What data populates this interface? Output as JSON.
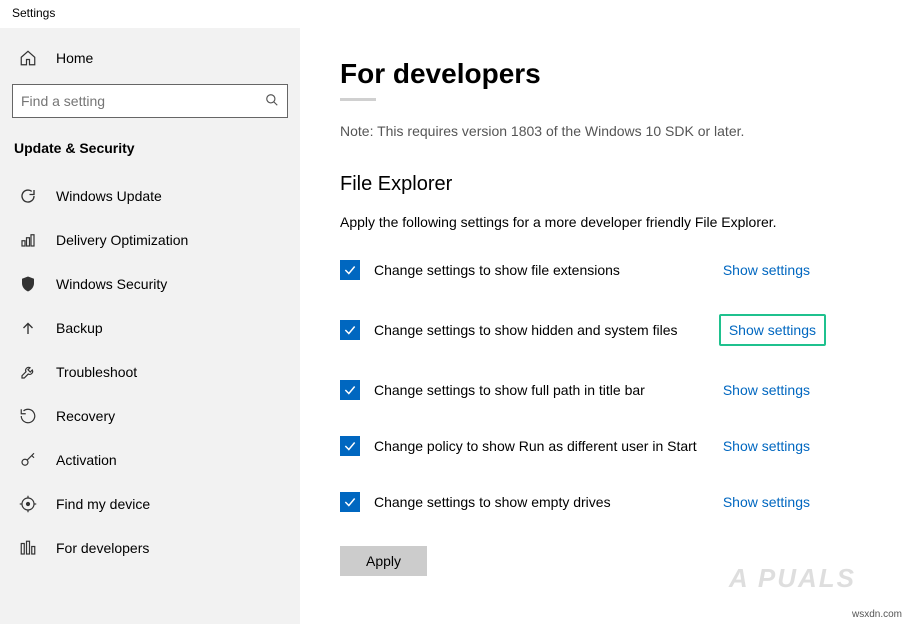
{
  "window": {
    "title": "Settings"
  },
  "sidebar": {
    "home": "Home",
    "search_placeholder": "Find a setting",
    "category": "Update & Security",
    "items": [
      {
        "label": "Windows Update"
      },
      {
        "label": "Delivery Optimization"
      },
      {
        "label": "Windows Security"
      },
      {
        "label": "Backup"
      },
      {
        "label": "Troubleshoot"
      },
      {
        "label": "Recovery"
      },
      {
        "label": "Activation"
      },
      {
        "label": "Find my device"
      },
      {
        "label": "For developers"
      }
    ]
  },
  "content": {
    "title": "For developers",
    "note": "Note: This requires version 1803 of the Windows 10 SDK or later.",
    "section_title": "File Explorer",
    "section_desc": "Apply the following settings for a more developer friendly File Explorer.",
    "link_text": "Show settings",
    "settings": [
      {
        "label": "Change settings to show file extensions",
        "checked": true
      },
      {
        "label": "Change settings to show hidden and system files",
        "checked": true,
        "highlight": true
      },
      {
        "label": "Change settings to show full path in title bar",
        "checked": true
      },
      {
        "label": "Change policy to show Run as different user in Start",
        "checked": true
      },
      {
        "label": "Change settings to show empty drives",
        "checked": true
      }
    ],
    "apply_button": "Apply"
  },
  "watermark": "wsxdn.com",
  "brand": "A   PUALS"
}
